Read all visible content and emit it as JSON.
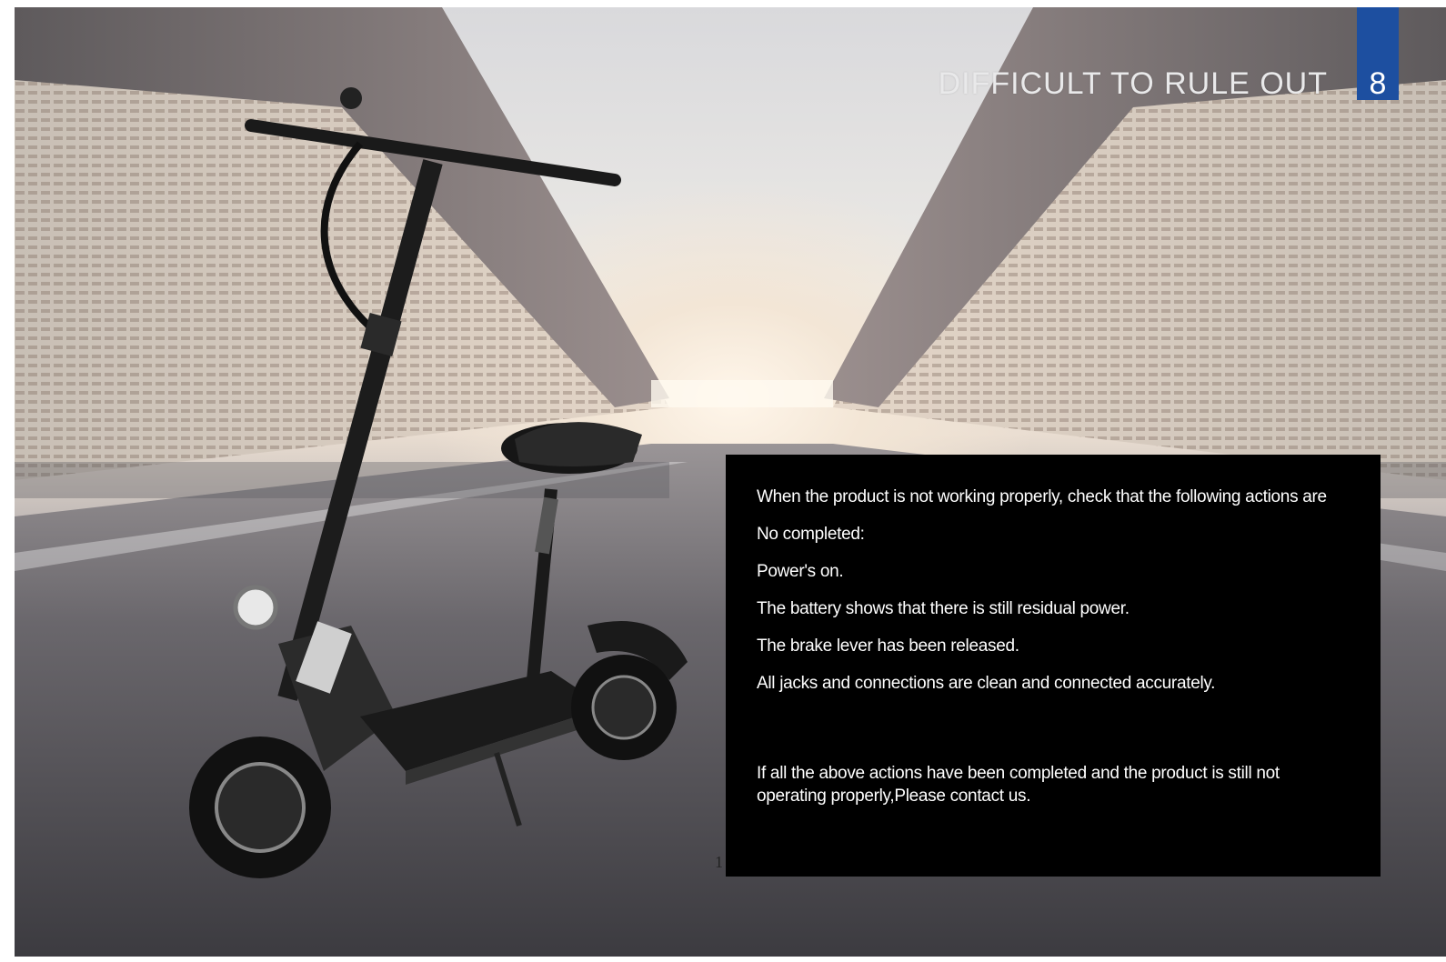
{
  "header": {
    "section_title": "DIFFICULT TO RULE OUT",
    "page_number": "8"
  },
  "panel": {
    "lines": [
      "When the product is not working properly, check that the following actions are",
      "No completed:",
      "Power's on.",
      "The battery shows that there is still residual power.",
      "The brake lever has been released.",
      "All jacks and connections are clean and connected accurately."
    ],
    "closing": "If all the above actions have been completed and the product is still not operating properly,Please contact us."
  },
  "stray_mark": "1",
  "colors": {
    "accent_blue": "#1d4fa0",
    "panel_bg": "#000000",
    "panel_text": "#ffffff"
  }
}
